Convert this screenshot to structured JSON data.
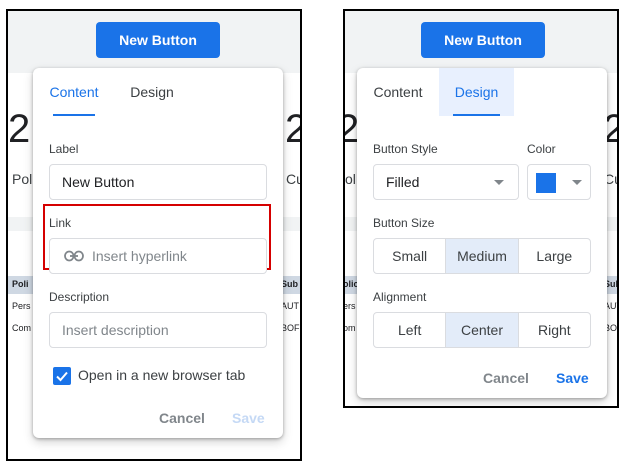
{
  "colors": {
    "accent": "#1a73e8",
    "highlight": "#d50000",
    "segment_selected": "#e3ecf9"
  },
  "background": {
    "new_button_label": "New Button",
    "big_number": "2",
    "left_labels": [
      "Pol",
      "Cu"
    ],
    "right_labels": [
      "ol",
      "Cus"
    ],
    "left_table": {
      "headers": [
        "Poli",
        "Sub"
      ],
      "rows": [
        [
          "Pers",
          "AUT"
        ],
        [
          "Com",
          "BOF"
        ]
      ]
    },
    "right_table": {
      "headers": [
        "olic",
        "Sub"
      ],
      "rows": [
        [
          "ers",
          "AUT"
        ],
        [
          "om",
          "BOR"
        ]
      ]
    }
  },
  "content_dialog": {
    "tabs": [
      {
        "label": "Content"
      },
      {
        "label": "Design"
      }
    ],
    "label_field": {
      "label": "Label",
      "value": "New Button"
    },
    "link_field": {
      "label": "Link",
      "placeholder": "Insert hyperlink",
      "icon": "link-icon"
    },
    "description_field": {
      "label": "Description",
      "placeholder": "Insert description"
    },
    "open_new_tab": {
      "label": "Open in a new browser tab",
      "checked": true
    },
    "cancel_label": "Cancel",
    "save_label": "Save"
  },
  "design_dialog": {
    "tabs": [
      {
        "label": "Content"
      },
      {
        "label": "Design"
      }
    ],
    "button_style": {
      "label": "Button Style",
      "value": "Filled"
    },
    "color": {
      "label": "Color",
      "value": "#1a73e8"
    },
    "button_size": {
      "label": "Button Size",
      "options": [
        "Small",
        "Medium",
        "Large"
      ],
      "selected": "Medium"
    },
    "alignment": {
      "label": "Alignment",
      "options": [
        "Left",
        "Center",
        "Right"
      ],
      "selected": "Center"
    },
    "cancel_label": "Cancel",
    "save_label": "Save"
  }
}
